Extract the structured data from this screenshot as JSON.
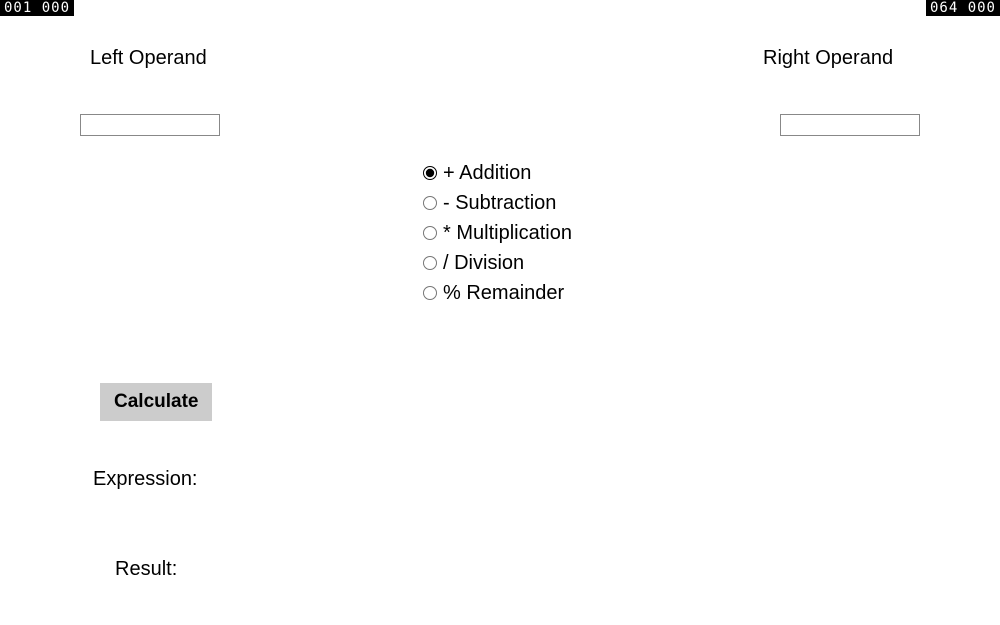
{
  "counters": {
    "left": "001  000",
    "right": "064  000"
  },
  "labels": {
    "left_operand": "Left Operand",
    "right_operand": "Right Operand",
    "expression": "Expression:",
    "result": "Result:"
  },
  "inputs": {
    "left_value": "",
    "right_value": ""
  },
  "operations": [
    {
      "label": "+ Addition",
      "checked": true
    },
    {
      "label": "- Subtraction",
      "checked": false
    },
    {
      "label": "* Multiplication",
      "checked": false
    },
    {
      "label": "/ Division",
      "checked": false
    },
    {
      "label": "% Remainder",
      "checked": false
    }
  ],
  "buttons": {
    "calculate": "Calculate"
  }
}
